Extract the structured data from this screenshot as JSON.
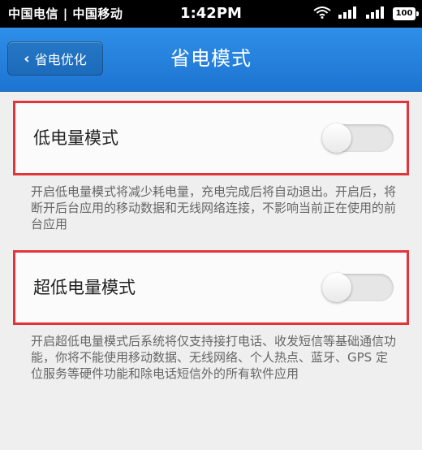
{
  "status_bar": {
    "carrier": "中国电信 | 中国移动",
    "time": "1:42PM",
    "battery": "100"
  },
  "nav": {
    "back_label": "省电优化",
    "title": "省电模式"
  },
  "settings": [
    {
      "label": "低电量模式",
      "enabled": false,
      "description": "开启低电量模式将减少耗电量，充电完成后将自动退出。开启后，将断开后台应用的移动数据和无线网络连接，不影响当前正在使用的前台应用"
    },
    {
      "label": "超低电量模式",
      "enabled": false,
      "description": "开启超低电量模式后系统将仅支持接打电话、收发短信等基础通信功能，你将不能使用移动数据、无线网络、个人热点、蓝牙、GPS 定位服务等硬件功能和除电话短信外的所有软件应用"
    }
  ],
  "colors": {
    "nav_bar": "#1d74d1",
    "highlight": "#e2353a",
    "background": "#efefef"
  }
}
